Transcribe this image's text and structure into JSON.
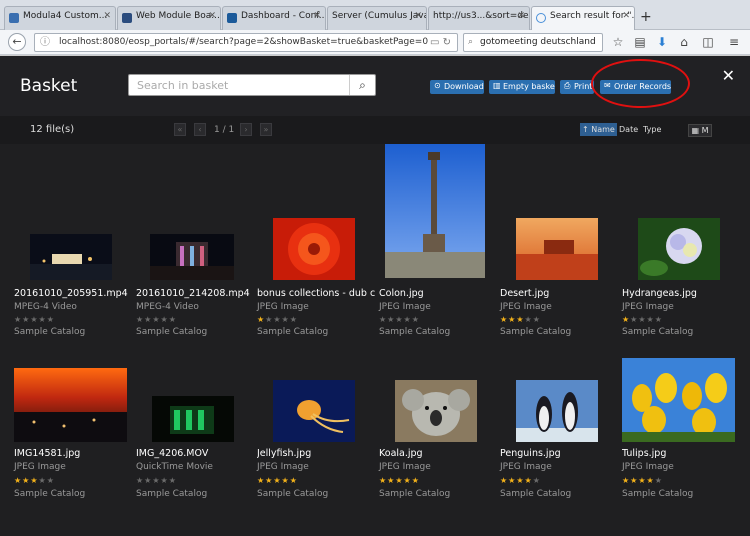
{
  "browser": {
    "tabs": [
      {
        "label": "Modula4 Custom...",
        "active": false
      },
      {
        "label": "Web Module Boa...",
        "active": false
      },
      {
        "label": "Dashboard - Conf...",
        "active": false
      },
      {
        "label": "Server (Cumulus Java ...",
        "active": false
      },
      {
        "label": "http://us3...&sort=desc",
        "active": false
      },
      {
        "label": "Search result for \"...",
        "active": true
      }
    ],
    "url": "localhost:8080/eosp_portals/#/search?page=2&showBasket=true&basketPage=0",
    "search_value": "gotomeeting deutschland"
  },
  "basket": {
    "title": "Basket",
    "search_placeholder": "Search in basket",
    "actions": {
      "download": "Download",
      "empty": "Empty basket",
      "print": "Print",
      "order": "Order Records"
    },
    "file_count": "12 file(s)",
    "pager": "1 / 1",
    "sort": {
      "name": "Name",
      "date": "Date",
      "type": "Type"
    },
    "view_label": "M"
  },
  "files": [
    {
      "name": "20161010_205951.mp4",
      "type": "MPEG-4 Video",
      "rating": 0,
      "catalog": "Sample Catalog"
    },
    {
      "name": "20161010_214208.mp4",
      "type": "MPEG-4 Video",
      "rating": 0,
      "catalog": "Sample Catalog"
    },
    {
      "name": "bonus collections - dub cr...",
      "type": "JPEG Image",
      "rating": 1,
      "catalog": "Sample Catalog"
    },
    {
      "name": "Colon.jpg",
      "type": "JPEG Image",
      "rating": 0,
      "catalog": "Sample Catalog"
    },
    {
      "name": "Desert.jpg",
      "type": "JPEG Image",
      "rating": 3,
      "catalog": "Sample Catalog"
    },
    {
      "name": "Hydrangeas.jpg",
      "type": "JPEG Image",
      "rating": 1,
      "catalog": "Sample Catalog"
    },
    {
      "name": "IMG14581.jpg",
      "type": "JPEG Image",
      "rating": 3,
      "catalog": "Sample Catalog"
    },
    {
      "name": "IMG_4206.MOV",
      "type": "QuickTime Movie",
      "rating": 0,
      "catalog": "Sample Catalog"
    },
    {
      "name": "Jellyfish.jpg",
      "type": "JPEG Image",
      "rating": 5,
      "catalog": "Sample Catalog"
    },
    {
      "name": "Koala.jpg",
      "type": "JPEG Image",
      "rating": 5,
      "catalog": "Sample Catalog"
    },
    {
      "name": "Penguins.jpg",
      "type": "JPEG Image",
      "rating": 4,
      "catalog": "Sample Catalog"
    },
    {
      "name": "Tulips.jpg",
      "type": "JPEG Image",
      "rating": 4,
      "catalog": "Sample Catalog"
    }
  ]
}
